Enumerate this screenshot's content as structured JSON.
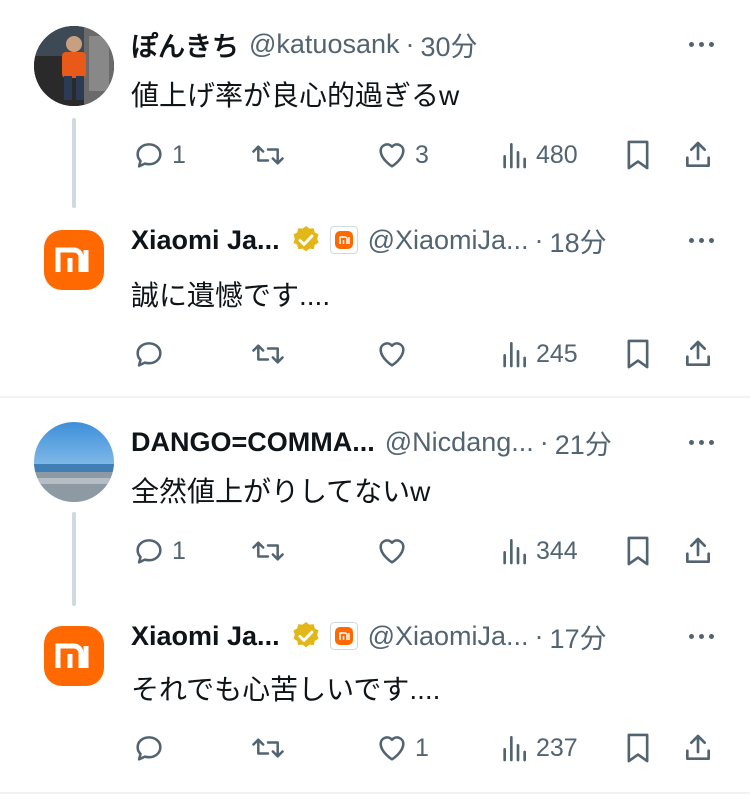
{
  "tweets": [
    {
      "name": "ぽんきち",
      "handle": "@katuosank",
      "dot": "·",
      "time": "30分",
      "text": "値上げ率が良心的過ぎるw",
      "replies": "1",
      "retweets": "",
      "likes": "3",
      "views": "480",
      "avatar": "photo-person-avatar"
    },
    {
      "name": "Xiaomi Ja...",
      "handle": "@XiaomiJa...",
      "dot": "·",
      "time": "18分",
      "text": "誠に遺憾です....",
      "replies": "",
      "retweets": "",
      "likes": "",
      "views": "245",
      "avatar": "xiaomi-logo",
      "verified": true
    },
    {
      "name": "DANGO=COMMA...",
      "handle": "@Nicdang...",
      "dot": "·",
      "time": "21分",
      "text": "全然値上がりしてないw",
      "replies": "1",
      "retweets": "",
      "likes": "",
      "views": "344",
      "avatar": "photo-seaside-avatar"
    },
    {
      "name": "Xiaomi Ja...",
      "handle": "@XiaomiJa...",
      "dot": "·",
      "time": "17分",
      "text": "それでも心苦しいです....",
      "replies": "",
      "retweets": "",
      "likes": "1",
      "views": "237",
      "avatar": "xiaomi-logo",
      "verified": true
    }
  ],
  "colors": {
    "text": "#0f1419",
    "secondary": "#536471",
    "brand": "#ff6900",
    "verified_gold": "#e2b719",
    "line": "#cfd9de"
  },
  "brand_logo_text": "mi"
}
